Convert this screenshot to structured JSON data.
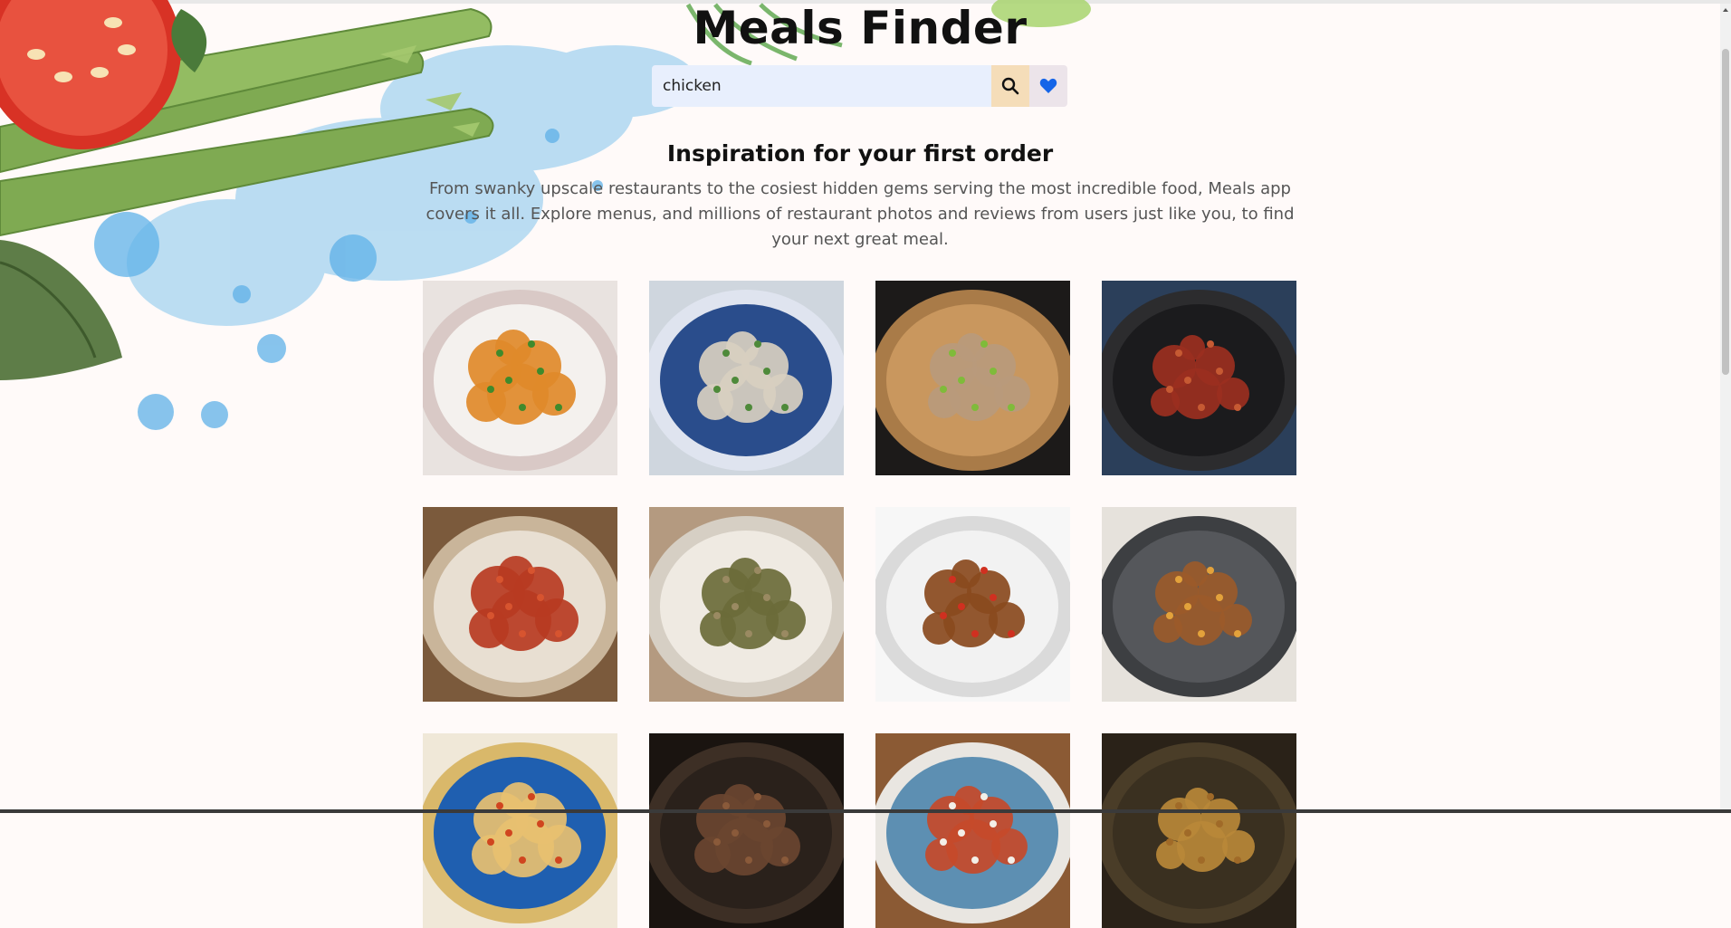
{
  "app": {
    "title": "Meals Finder"
  },
  "search": {
    "value": "chicken",
    "button_icon": "search-icon",
    "favorites_icon": "heart-icon"
  },
  "intro": {
    "heading": "Inspiration for your first order",
    "description": "From swanky upscale restaurants to the cosiest hidden gems serving the most incredible food, Meals app covers it all. Explore menus, and millions of restaurant photos and reviews from users just like you, to find your next great meal."
  },
  "colors": {
    "page_background": "#fffaf9",
    "search_field": "#e8effd",
    "search_button": "#f5ddb9",
    "favorite_button": "#ece4ea",
    "heart": "#1565e8"
  },
  "meals": [
    {
      "name": "meal-card-1",
      "plate": "#f4f1ee",
      "rim": "#d9c9c6",
      "food": "#e08a2a",
      "accent": "#3f8a2c",
      "bg": "#e9e3e0"
    },
    {
      "name": "meal-card-2",
      "plate": "#2a4d8c",
      "rim": "#dfe4ef",
      "food": "#d8cfc0",
      "accent": "#4e8a3a",
      "bg": "#cfd6de"
    },
    {
      "name": "meal-card-3",
      "plate": "#c9975e",
      "rim": "#a97b48",
      "food": "#b99a7c",
      "accent": "#7fbb3a",
      "bg": "#1c1a19"
    },
    {
      "name": "meal-card-4",
      "plate": "#1b1b1d",
      "rim": "#2c2c2e",
      "food": "#9b2f20",
      "accent": "#c65a33",
      "bg": "#2b3f5a"
    },
    {
      "name": "meal-card-5",
      "plate": "#e8dfd2",
      "rim": "#c9b59a",
      "food": "#b73b22",
      "accent": "#d7542f",
      "bg": "#7b5a3c"
    },
    {
      "name": "meal-card-6",
      "plate": "#efeae2",
      "rim": "#d6cfc4",
      "food": "#6b6b3a",
      "accent": "#9a8a62",
      "bg": "#b49a80"
    },
    {
      "name": "meal-card-7",
      "plate": "#f2f2f2",
      "rim": "#dadada",
      "food": "#8a4a1e",
      "accent": "#d03020",
      "bg": "#f7f7f7"
    },
    {
      "name": "meal-card-8",
      "plate": "#55575b",
      "rim": "#3d3f42",
      "food": "#9b5a2a",
      "accent": "#e3a23b",
      "bg": "#e6e2dc"
    },
    {
      "name": "meal-card-9",
      "plate": "#1f5fb0",
      "rim": "#d9b86a",
      "food": "#e8c070",
      "accent": "#d0451f",
      "bg": "#f0e8d8"
    },
    {
      "name": "meal-card-10",
      "plate": "#2a211b",
      "rim": "#3d2f25",
      "food": "#6a4530",
      "accent": "#8a5a3a",
      "bg": "#1a1410"
    },
    {
      "name": "meal-card-11",
      "plate": "#5d8fb2",
      "rim": "#e9e6e1",
      "food": "#c64a2a",
      "accent": "#f3efe8",
      "bg": "#8b5a34"
    },
    {
      "name": "meal-card-12",
      "plate": "#3a3020",
      "rim": "#4a3d28",
      "food": "#b88838",
      "accent": "#a06a28",
      "bg": "#2a2218"
    }
  ]
}
